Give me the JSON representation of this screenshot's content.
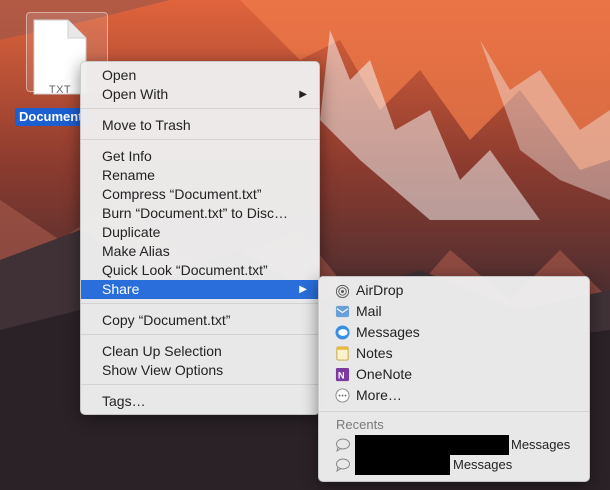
{
  "desktop": {
    "file": {
      "type_label": "TXT",
      "name": "Document"
    }
  },
  "context_menu": {
    "groups": [
      [
        {
          "label": "Open"
        },
        {
          "label": "Open With",
          "submenu": true
        }
      ],
      [
        {
          "label": "Move to Trash"
        }
      ],
      [
        {
          "label": "Get Info"
        },
        {
          "label": "Rename"
        },
        {
          "label": "Compress “Document.txt”"
        },
        {
          "label": "Burn “Document.txt” to Disc…"
        },
        {
          "label": "Duplicate"
        },
        {
          "label": "Make Alias"
        },
        {
          "label": "Quick Look “Document.txt”"
        },
        {
          "label": "Share",
          "submenu": true,
          "selected": true
        }
      ],
      [
        {
          "label": "Copy “Document.txt”"
        }
      ],
      [
        {
          "label": "Clean Up Selection"
        },
        {
          "label": "Show View Options"
        }
      ],
      [
        {
          "label": "Tags…"
        }
      ]
    ]
  },
  "share_menu": {
    "items": [
      {
        "label": "AirDrop",
        "icon": "airdrop-icon"
      },
      {
        "label": "Mail",
        "icon": "mail-icon"
      },
      {
        "label": "Messages",
        "icon": "messages-icon"
      },
      {
        "label": "Notes",
        "icon": "notes-icon"
      },
      {
        "label": "OneNote",
        "icon": "onenote-icon"
      },
      {
        "label": "More…",
        "icon": "more-icon"
      }
    ],
    "recents_label": "Recents",
    "recents": [
      {
        "app": "Messages"
      },
      {
        "app": "Messages"
      }
    ]
  },
  "colors": {
    "selection": "#2a6edb",
    "file_label_bg": "#1c5fd1",
    "menu_bg": "#eeeeee"
  }
}
